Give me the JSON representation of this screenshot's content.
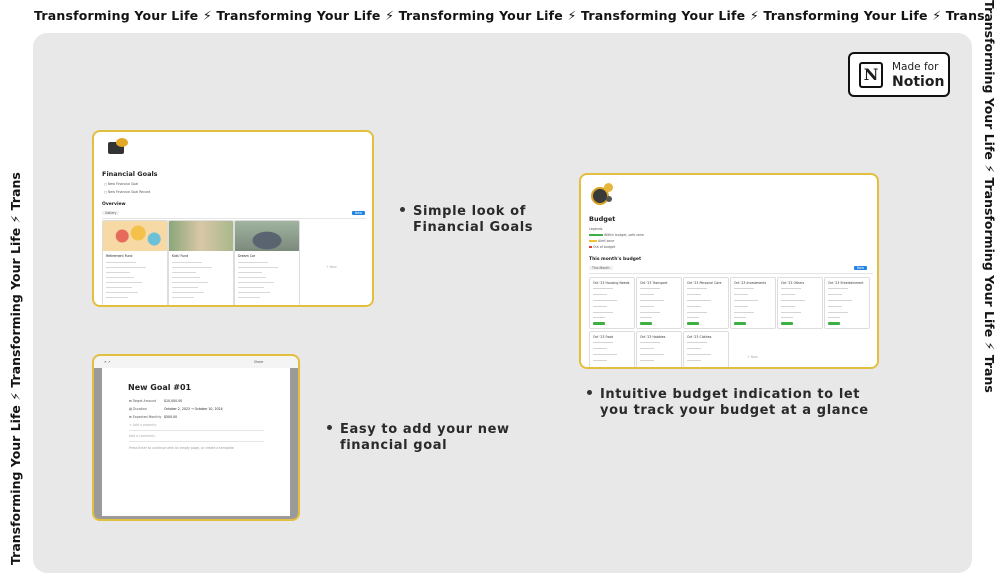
{
  "marquee": {
    "top": "Transforming Your Life ⚡ Transforming Your Life ⚡ Transforming Your Life ⚡ Transforming Your Life ⚡ Transforming Your Life ⚡ Transformin",
    "left": "Transforming Your Life ⚡ Transforming Your Life ⚡ Trans",
    "right": "Transforming Your Life ⚡ Transforming Your Life ⚡ Trans"
  },
  "badge": {
    "made_for": "Made for",
    "notion": "Notion",
    "logo_letter": "N"
  },
  "card_goals": {
    "title": "Financial Goals",
    "btn_new_goal": "New Financial Goal",
    "btn_new_record": "New Financial Goal Record",
    "overview": "Overview",
    "view_tab": "Gallery",
    "new_btn": "New",
    "items": [
      {
        "name": "Retirement Fund",
        "color": "#f3b04a"
      },
      {
        "name": "Kids' Fund",
        "color": "#8cae6c"
      },
      {
        "name": "Dream Car",
        "color": "#6d7b8a"
      }
    ],
    "add_new": "+ New"
  },
  "card_budget": {
    "title": "Budget",
    "legends": "Legends",
    "legend_items": [
      "Within budget, safe zone",
      "Alert zone",
      "Out of budget"
    ],
    "this_month": "This month's budget",
    "view_tab": "This Month",
    "new_btn": "New",
    "categories": [
      "Oct '23 Housing Needs",
      "Oct '23 Transport",
      "Oct '23 Personal Care",
      "Oct '23 Investments",
      "Oct '23 Others",
      "Oct '23 Entertainment",
      "Oct '23 Food",
      "Oct '23 Hobbies",
      "Oct '23 Clothes"
    ],
    "add_new": "+ New"
  },
  "card_new_goal": {
    "title": "New Goal #01",
    "props": [
      "Target Amount",
      "Duration",
      "Expected Monthly"
    ],
    "values": [
      "$10,000.00",
      "October 2, 2023 → October 10, 2024",
      "$500.00"
    ],
    "add_property": "+ Add a property",
    "comment": "Add a comment...",
    "hint": "Press Enter to continue with an empty page, or create a template",
    "topbar": "Share"
  },
  "bullets": {
    "b1": [
      "Simple look of",
      "Financial Goals"
    ],
    "b2": [
      "Intuitive budget indication to let",
      "you track your budget at a glance"
    ],
    "b3": [
      "Easy to add your new",
      "financial goal"
    ]
  }
}
